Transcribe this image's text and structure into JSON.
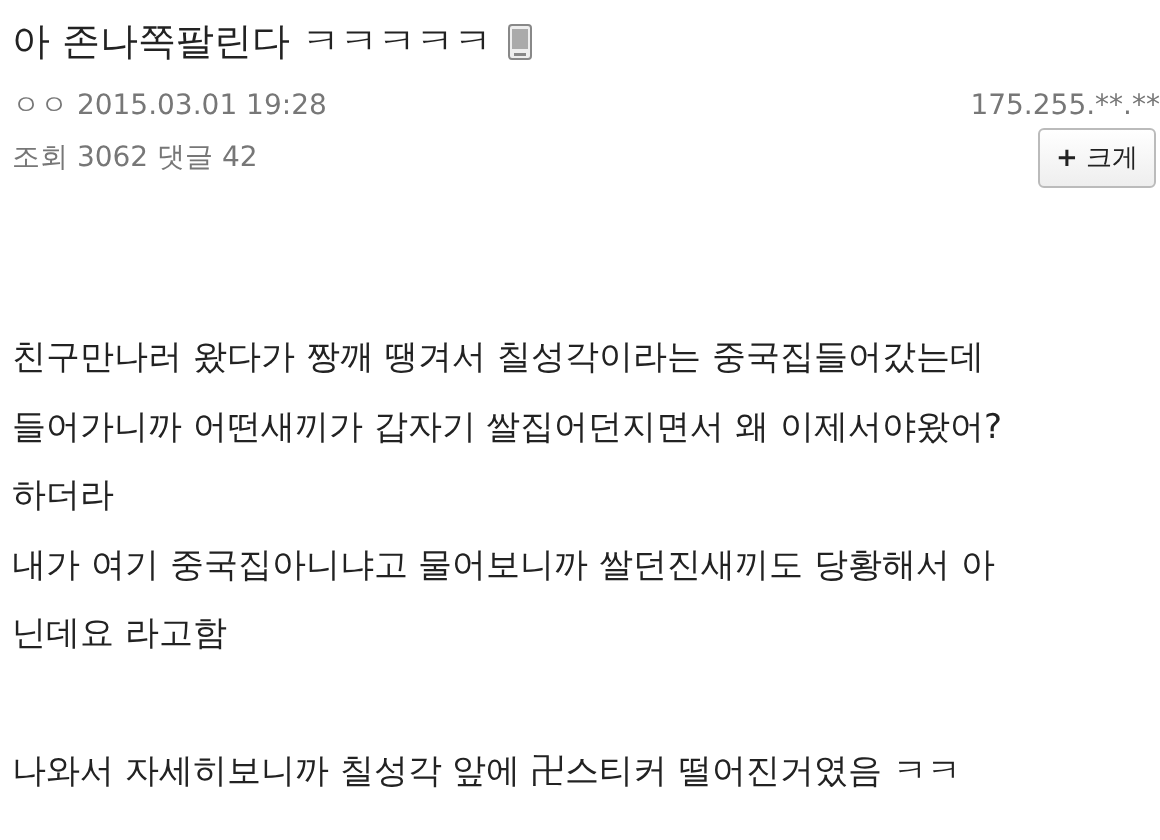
{
  "post": {
    "title": "아 존나쪽팔린다 ㅋㅋㅋㅋㅋ",
    "author": "ㅇㅇ",
    "datetime": "2015.03.01 19:28",
    "ip": "175.255.**.**",
    "views_label": "조회",
    "views": "3062",
    "comments_label": "댓글",
    "comments": "42",
    "zoom_button": {
      "icon": "+",
      "label": "크게"
    }
  },
  "body": [
    {
      "lines": [
        "친구만나러 왔다가 짱깨 땡겨서 칠성각이라는 중국집들어갔는데",
        "들어가니까 어떤새끼가 갑자기 쌀집어던지면서 왜 이제서야왔어?",
        "하더라",
        "내가 여기 중국집아니냐고 물어보니까 쌀던진새끼도 당황해서 아",
        "닌데요 라고함"
      ]
    },
    {
      "lines": [
        "나와서 자세히보니까 칠성각 앞에 卍스티커 떨어진거였음 ㅋㅋ"
      ]
    }
  ]
}
